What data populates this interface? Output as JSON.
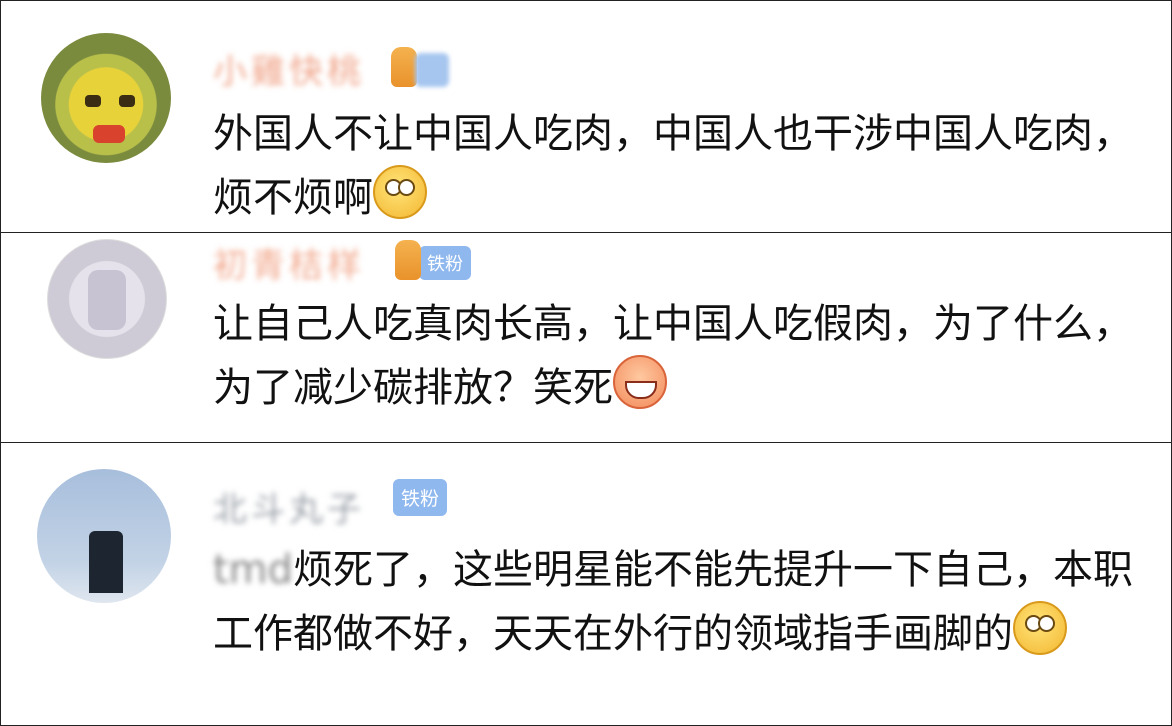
{
  "comments": [
    {
      "username": "小雞快桃",
      "badge": "",
      "text": "外国人不让中国人吃肉，中国人也干涉中国人吃肉，烦不烦啊",
      "emoji": "eye-roll-emoji"
    },
    {
      "username": "初青桔样",
      "badge": "铁粉",
      "text": "让自己人吃真肉长高，让中国人吃假肉，为了什么，为了减少碳排放？笑死",
      "emoji": "laugh-emoji"
    },
    {
      "username": "北斗丸子",
      "badge": "铁粉",
      "mention": "tmd",
      "text": "烦死了，这些明星能不能先提升一下自己，本职工作都做不好，天天在外行的领域指手画脚的",
      "emoji": "eye-roll-emoji"
    }
  ]
}
